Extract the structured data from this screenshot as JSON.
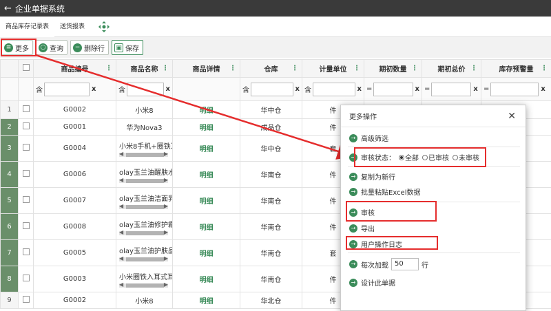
{
  "app": {
    "title": "企业单据系统"
  },
  "tabs": [
    {
      "label": "商品库存记录表"
    },
    {
      "label": "送货报表"
    }
  ],
  "toolbar": {
    "more_label": "更多",
    "query_label": "查询",
    "delete_label": "删除行",
    "save_label": "保存"
  },
  "grid": {
    "columns": [
      "商品编号",
      "商品名称",
      "商品详情",
      "仓库",
      "计量单位",
      "期初数量",
      "期初总价",
      "库存预警量"
    ],
    "filters": {
      "contains": "含",
      "equals": "=",
      "clear": "x"
    },
    "rows": [
      {
        "num": "1",
        "code": "G0002",
        "name": "小米8",
        "detail": "明细",
        "warehouse": "华中仓",
        "unit": "件"
      },
      {
        "num": "2",
        "code": "G0001",
        "name": "华为Nova3",
        "detail": "明细",
        "warehouse": "成品仓",
        "unit": "件"
      },
      {
        "num": "3",
        "code": "G0004",
        "name": "小米8手机+圈铁耳机",
        "detail": "明细",
        "warehouse": "华中仓",
        "unit": "套"
      },
      {
        "num": "4",
        "code": "G0006",
        "name": "olay玉兰油醒肤水15",
        "detail": "明细",
        "warehouse": "华南仓",
        "unit": "件"
      },
      {
        "num": "5",
        "code": "G0007",
        "name": "olay玉兰油洁面乳10",
        "detail": "明细",
        "warehouse": "华南仓",
        "unit": "件"
      },
      {
        "num": "6",
        "code": "G0008",
        "name": "olay玉兰油修护霜50",
        "detail": "明细",
        "warehouse": "华南仓",
        "unit": "件"
      },
      {
        "num": "7",
        "code": "G0005",
        "name": "olay玉兰油护肤品套",
        "detail": "明细",
        "warehouse": "华南仓",
        "unit": "套"
      },
      {
        "num": "8",
        "code": "G0003",
        "name": "小米圈铁入耳式耳机",
        "detail": "明细",
        "warehouse": "华南仓",
        "unit": "件"
      },
      {
        "num": "9",
        "code": "G0002",
        "name": "小米8",
        "detail": "明细",
        "warehouse": "华北仓",
        "unit": "件"
      }
    ]
  },
  "modal": {
    "title": "更多操作",
    "advanced_filter": "高级筛选",
    "audit_status_label": "审核状态：",
    "audit_options": [
      "全部",
      "已审核",
      "未审核"
    ],
    "copy_new": "复制为新行",
    "paste_excel": "批量粘贴Excel数据",
    "audit": "审核",
    "export": "导出",
    "user_log": "用户操作日志",
    "load_prefix": "每次加载",
    "load_value": "50",
    "load_suffix": "行",
    "design": "设计此单据"
  },
  "colors": {
    "accent": "#3b8c5a",
    "highlight": "#e52d2d",
    "titlebar": "#3a3a3a"
  }
}
